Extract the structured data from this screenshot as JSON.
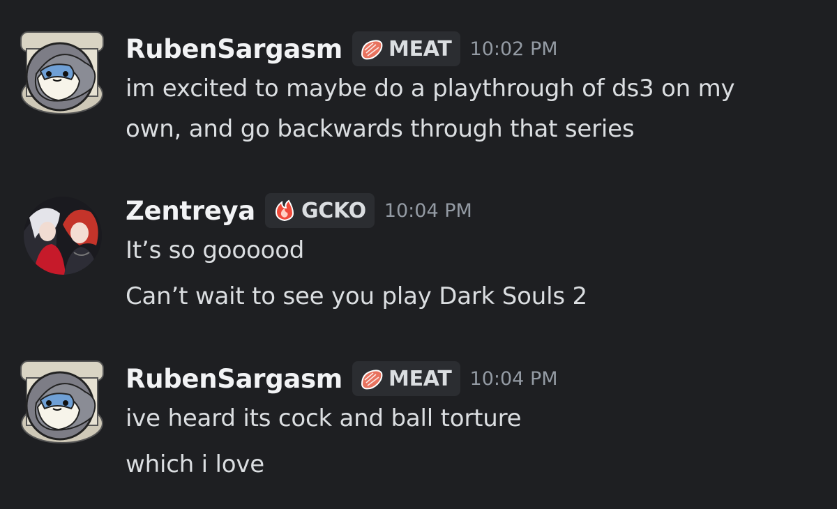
{
  "messages": [
    {
      "username": "RubenSargasm",
      "tag": {
        "label": "MEAT",
        "icon": "meat-icon"
      },
      "timestamp": "10:02 PM",
      "lines": [
        "im excited to maybe do a playthrough of ds3 on my",
        "own, and go backwards through that series"
      ]
    },
    {
      "username": "Zentreya",
      "tag": {
        "label": "GCKO",
        "icon": "fire-icon"
      },
      "timestamp": "10:04 PM",
      "lines": [
        "It’s so goooood",
        "Can’t wait to see you play Dark Souls 2"
      ]
    },
    {
      "username": "RubenSargasm",
      "tag": {
        "label": "MEAT",
        "icon": "meat-icon"
      },
      "timestamp": "10:04 PM",
      "lines": [
        "ive heard its cock and ball torture",
        "which i love"
      ]
    }
  ],
  "colors": {
    "background": "#1e1f22",
    "username": "#f2f3f5",
    "text": "#dbdee1",
    "timestamp": "#949ba4",
    "tag_bg": "#2b2d31",
    "meat": "#e8735f",
    "fire": "#f04a3a"
  }
}
